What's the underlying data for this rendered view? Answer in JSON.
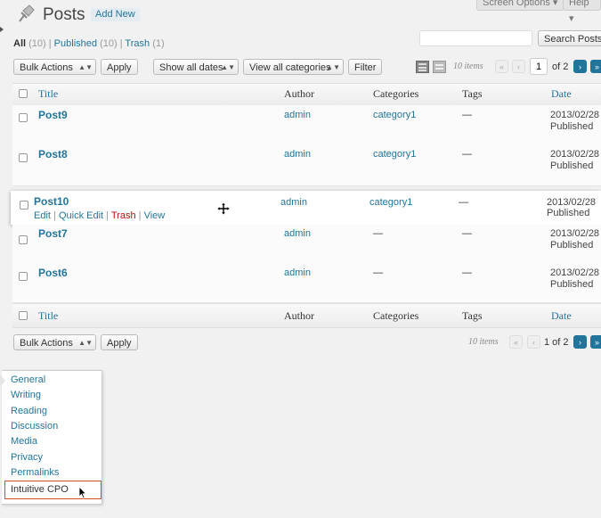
{
  "header": {
    "title": "Posts",
    "add_new": "Add New",
    "screen_options": "Screen Options ▾",
    "help": "Help ▾"
  },
  "subsubsub": {
    "all_label": "All",
    "all_count": "(10)",
    "published_label": "Published",
    "published_count": "(10)",
    "trash_label": "Trash",
    "trash_count": "(1)",
    "sep": "|"
  },
  "search": {
    "value": "",
    "button": "Search Posts"
  },
  "top_nav": {
    "bulk_actions": "Bulk Actions",
    "apply": "Apply",
    "dates": "Show all dates",
    "categories": "View all categories",
    "filter": "Filter",
    "items": "10 items",
    "first": "«",
    "prev": "‹",
    "page": "1",
    "of_pages": "of 2",
    "next": "›",
    "last": "»"
  },
  "columns": {
    "title": "Title",
    "author": "Author",
    "categories": "Categories",
    "tags": "Tags",
    "date": "Date"
  },
  "rows": [
    {
      "title": "Post9",
      "author": "admin",
      "category": "category1",
      "tags": "—",
      "date": "2013/02/28",
      "status": "Published"
    },
    {
      "title": "Post8",
      "author": "admin",
      "category": "category1",
      "tags": "—",
      "date": "2013/02/28",
      "status": "Published"
    },
    {
      "title": "Post10",
      "author": "admin",
      "category": "category1",
      "tags": "—",
      "date": "2013/02/28",
      "status": "Published"
    },
    {
      "title": "Post7",
      "author": "admin",
      "category": "—",
      "tags": "—",
      "date": "2013/02/28",
      "status": "Published"
    },
    {
      "title": "Post6",
      "author": "admin",
      "category": "—",
      "tags": "—",
      "date": "2013/02/28",
      "status": "Published"
    }
  ],
  "row_actions": {
    "edit": "Edit",
    "quick_edit": "Quick Edit",
    "trash": "Trash",
    "view": "View",
    "sep": "|"
  },
  "bottom_nav": {
    "bulk_actions": "Bulk Actions",
    "apply": "Apply",
    "items": "10 items",
    "first": "«",
    "prev": "‹",
    "page_text": "1 of 2",
    "next": "›",
    "last": "»"
  },
  "settings_menu": [
    "General",
    "Writing",
    "Reading",
    "Discussion",
    "Media",
    "Privacy",
    "Permalinks",
    "Intuitive CPO"
  ],
  "colors": {
    "link": "#21759b",
    "trash": "#bc0b0b",
    "highlight_border": "#d54e21"
  },
  "icons": {
    "posts": "pushpin-icon",
    "drag": "move-cursor-icon",
    "pointer": "mouse-pointer-icon"
  }
}
